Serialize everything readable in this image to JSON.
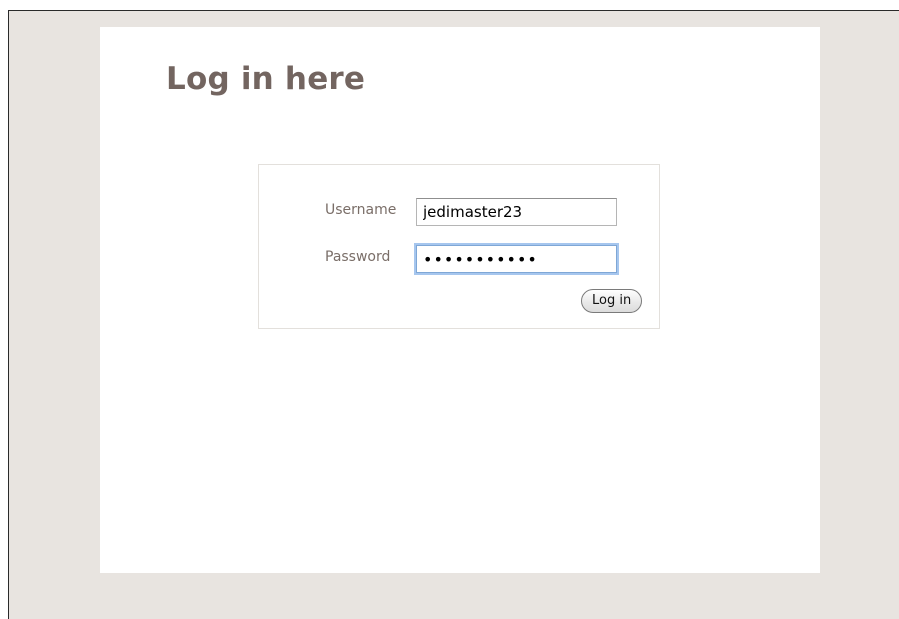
{
  "page": {
    "title": "Log in here"
  },
  "login_form": {
    "username_label": "Username",
    "username_value": "jedimaster23",
    "password_label": "Password",
    "password_masked": "•••••••••••",
    "submit_label": "Log in"
  },
  "colors": {
    "background": "#e8e4e0",
    "panel": "#ffffff",
    "title_text": "#736560",
    "label_text": "#7a6e68",
    "focus_ring": "#a6c6ee"
  }
}
